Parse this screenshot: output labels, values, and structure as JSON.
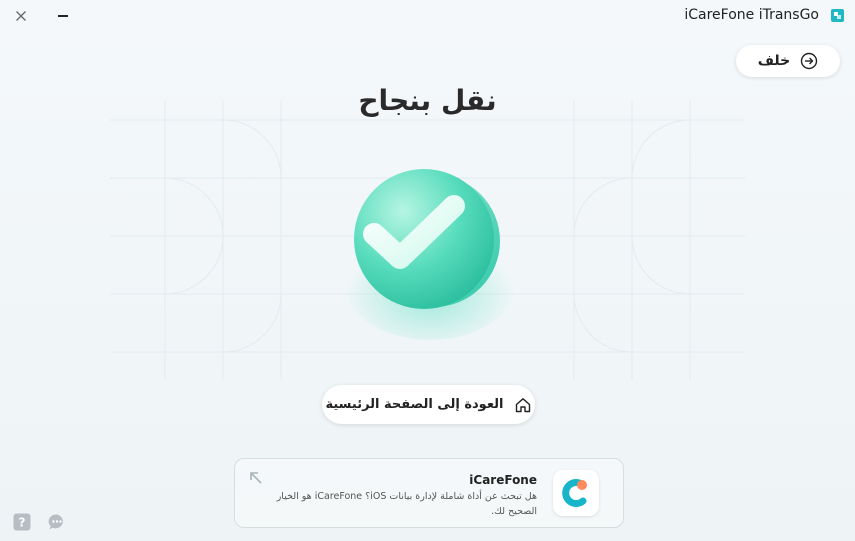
{
  "app": {
    "title": "iCareFone iTransGo",
    "colors": {
      "accent": "#3fcfb0",
      "background": "#f1f6f8",
      "text": "#2a2a2a"
    }
  },
  "window_controls": {
    "close_icon": "close-icon",
    "minimize_icon": "minimize-icon"
  },
  "back_button": {
    "label": "خلف",
    "icon": "arrow-right-circle-icon"
  },
  "main": {
    "heading": "نقل بنجاح",
    "illustration_icon": "success-check-icon"
  },
  "home_button": {
    "label": "العودة إلى الصفحة الرئيسية",
    "icon": "home-icon"
  },
  "promo": {
    "title": "iCareFone",
    "description": "هل تبحث عن أداة شاملة لإدارة بيانات iOS؟ iCareFone هو الخيار الصحيح لك.",
    "logo_icon": "icarefone-logo-icon",
    "arrow_icon": "arrow-up-left-icon"
  },
  "footer": {
    "help_icon": "help-icon",
    "feedback_icon": "chat-icon"
  }
}
